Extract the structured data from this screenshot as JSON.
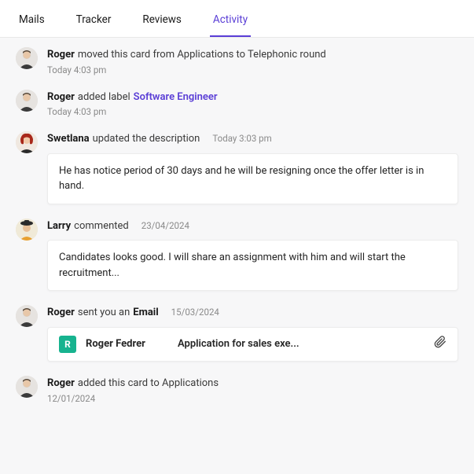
{
  "tabs": {
    "mails": "Mails",
    "tracker": "Tracker",
    "reviews": "Reviews",
    "activity": "Activity"
  },
  "items": [
    {
      "actor": "Roger",
      "action": "moved this card from Applications to Telephonic round",
      "timestamp": "Today 4:03 pm"
    },
    {
      "actor": "Roger",
      "action": "added label",
      "label": "Software Engineer",
      "timestamp": "Today 4:03 pm"
    },
    {
      "actor": "Swetlana",
      "action": "updated the description",
      "timestamp": "Today 3:03 pm",
      "content": "He has notice period of 30 days and he will be resigning once the offer letter is in hand."
    },
    {
      "actor": "Larry",
      "action": "commented",
      "timestamp": "23/04/2024",
      "content": "Candidates looks good. I will share an assignment with him and will start the recruitment..."
    },
    {
      "actor": "Roger",
      "action_pre": "sent you an",
      "action_bold": "Email",
      "timestamp": "15/03/2024",
      "email": {
        "initial": "R",
        "sender": "Roger Fedrer",
        "subject": "Application for sales exe..."
      }
    },
    {
      "actor": "Roger",
      "action": "added this card to Applications",
      "timestamp": "12/01/2024"
    }
  ]
}
